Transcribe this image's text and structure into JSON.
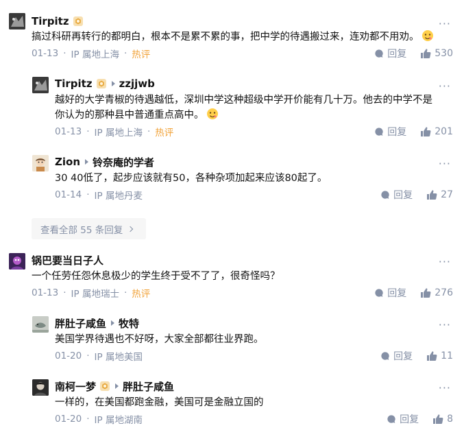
{
  "comments": [
    {
      "author": "Tirpitz",
      "text": "搞过科研再转行的都明白，根本不是累不累的事，把中学的待遇搬过来，连劝都不用劝。",
      "date": "01-13",
      "ip": "IP 属地上海",
      "hot": "热评",
      "reply_label": "回复",
      "likes": "530"
    },
    {
      "author": "Tirpitz",
      "reply_to": "zzjjwb",
      "text_line1": "越好的大学青椒的待遇越低，深圳中学这种超级中学开价能有几十万。他去的中学不是",
      "text_line2": "你认为的那种县中普通重点高中。",
      "date": "01-13",
      "ip": "IP 属地上海",
      "hot": "热评",
      "reply_label": "回复",
      "likes": "201"
    },
    {
      "author": "Zion",
      "reply_to": "铃奈庵的学者",
      "text": "30 40低了，起步应该就有50，各种杂项加起来应该80起了。",
      "date": "01-14",
      "ip": "IP 属地丹麦",
      "reply_label": "回复",
      "likes": "27"
    },
    {
      "author": "锅巴要当日子人",
      "text": "一个任劳任怨休息极少的学生终于受不了了，很奇怪吗？",
      "date": "01-13",
      "ip": "IP 属地瑞士",
      "hot": "热评",
      "reply_label": "回复",
      "likes": "276"
    },
    {
      "author": "胖肚子咸鱼",
      "reply_to": "牧特",
      "text": "美国学界待遇也不好呀，大家全部都往业界跑。",
      "date": "01-20",
      "ip": "IP 属地美国",
      "reply_label": "回复",
      "likes": "11"
    },
    {
      "author": "南柯一梦",
      "reply_to": "胖肚子咸鱼",
      "text": "一样的，在美国都跑金融，美国可是金融立国的",
      "date": "01-20",
      "ip": "IP 属地湖南",
      "reply_label": "回复",
      "likes": "8"
    }
  ],
  "view_all": "查看全部 55 条回复",
  "more_glyph": "···",
  "colors": {
    "hot": "#f1a33a",
    "meta": "#8590a6",
    "badge": "#f2c066"
  }
}
